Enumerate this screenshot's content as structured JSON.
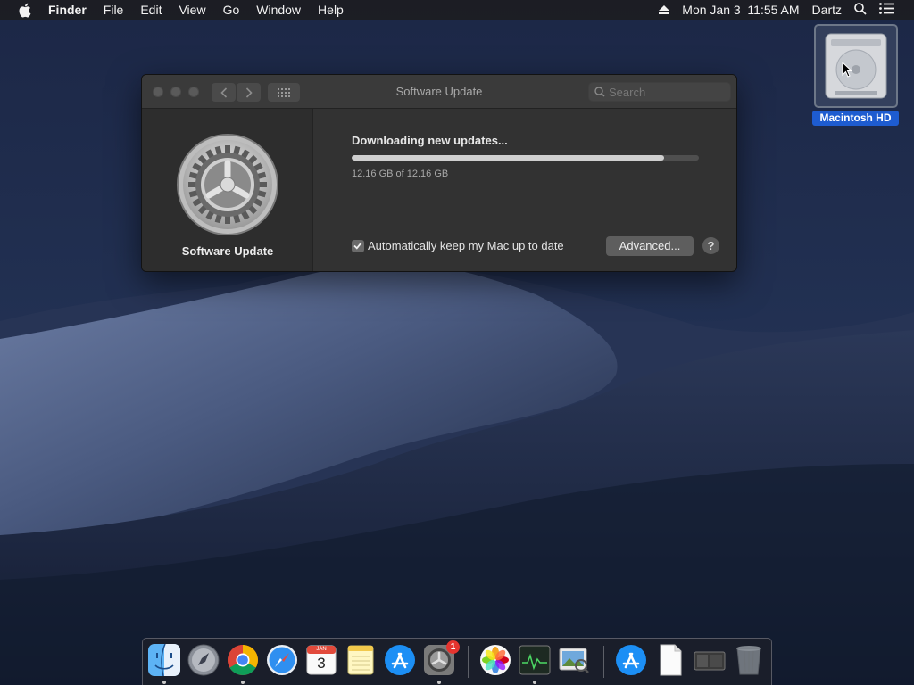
{
  "menubar": {
    "app_name": "Finder",
    "menus": [
      "File",
      "Edit",
      "View",
      "Go",
      "Window",
      "Help"
    ],
    "clock": "Mon Jan 3  11:55 AM",
    "user": "Dartz"
  },
  "desktop": {
    "disk_label": "Macintosh HD"
  },
  "window": {
    "title": "Software Update",
    "search_placeholder": "Search",
    "sidebar_label": "Software Update",
    "status": "Downloading new updates...",
    "progress_fraction": 0.9,
    "size_text": "12.16 GB of 12.16 GB",
    "auto_update_label": "Automatically keep my Mac up to date",
    "auto_update_checked": true,
    "advanced_label": "Advanced...",
    "help_label": "?"
  },
  "dock": {
    "items": [
      {
        "icon": "finder-icon",
        "running": true
      },
      {
        "icon": "launchpad-icon",
        "running": false
      },
      {
        "icon": "chrome-icon",
        "running": true
      },
      {
        "icon": "safari-icon",
        "running": false
      },
      {
        "icon": "calendar-icon",
        "running": false,
        "month": "JAN",
        "day": "3"
      },
      {
        "icon": "notes-icon",
        "running": false
      },
      {
        "icon": "app-store-icon",
        "running": false
      },
      {
        "icon": "system-preferences-icon",
        "running": true,
        "badge": "1"
      },
      {
        "icon": "photos-icon",
        "running": false
      },
      {
        "icon": "activity-monitor-icon",
        "running": true
      },
      {
        "icon": "preview-icon",
        "running": false
      },
      {
        "icon": "app-store-downloads-icon",
        "running": false
      },
      {
        "icon": "document-icon",
        "running": false
      },
      {
        "icon": "disk-image-icon",
        "running": false
      },
      {
        "icon": "trash-icon",
        "running": false
      }
    ]
  },
  "colors": {
    "accent": "#1e5cd0",
    "window_bg": "#323232",
    "badge": "#e5342f"
  }
}
